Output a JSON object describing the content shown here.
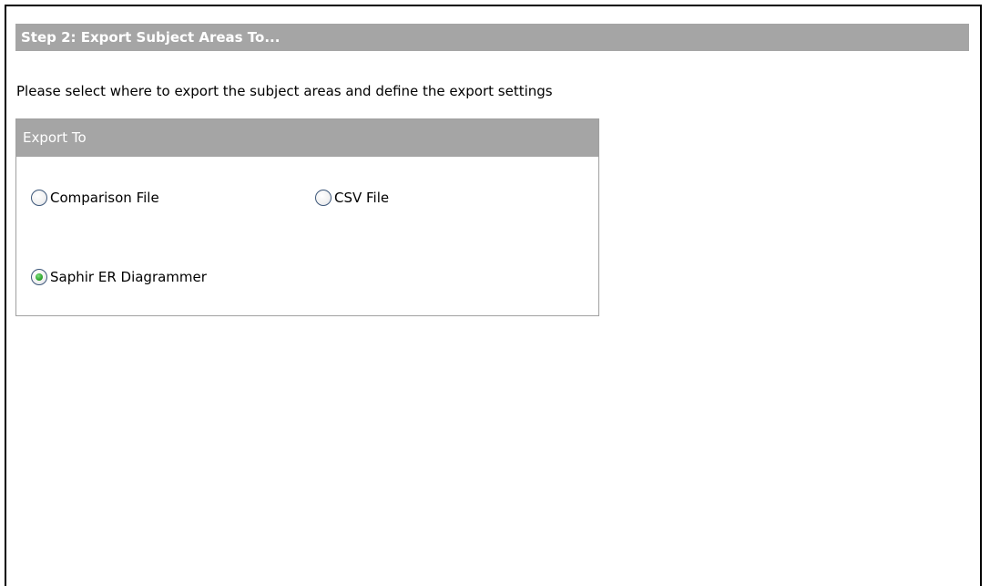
{
  "step": {
    "title": "Step 2: Export Subject Areas To..."
  },
  "instructions": "Please select where to export the subject areas and define the export settings",
  "export_group": {
    "title": "Export To",
    "options": [
      {
        "label": "Comparison File",
        "selected": false
      },
      {
        "label": "CSV File",
        "selected": false
      },
      {
        "label": "Saphir ER Diagrammer",
        "selected": true
      }
    ]
  },
  "colors": {
    "header_background": "#a5a5a5",
    "header_text": "#ffffff",
    "selected_dot": "#2ea52e"
  }
}
